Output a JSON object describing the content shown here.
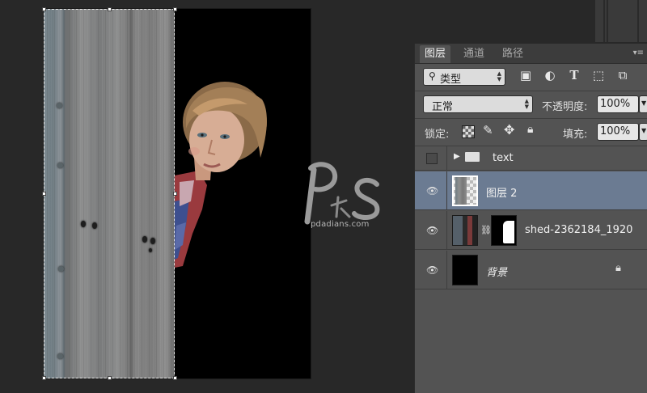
{
  "panel": {
    "tabs": [
      {
        "label": "图层",
        "active": true
      },
      {
        "label": "通道",
        "active": false
      },
      {
        "label": "路径",
        "active": false
      }
    ],
    "filter": {
      "label": "类型",
      "icon": "search-icon"
    },
    "filter_icons": [
      "image-filter-icon",
      "adjustment-filter-icon",
      "type-filter-icon",
      "shape-filter-icon",
      "smart-object-filter-icon"
    ],
    "blend_mode": "正常",
    "opacity_label": "不透明度:",
    "opacity_value": "100%",
    "lock_label": "锁定:",
    "fill_label": "填充:",
    "fill_value": "100%",
    "lock_icons": [
      "lock-transparent-icon",
      "lock-paint-icon",
      "lock-move-icon",
      "lock-all-icon"
    ]
  },
  "layers": [
    {
      "name": "text",
      "type": "group",
      "visible": false,
      "selected": false
    },
    {
      "name": "图层 2",
      "type": "pixel",
      "visible": true,
      "selected": true
    },
    {
      "name": "shed-2362184_1920",
      "type": "masked",
      "visible": true,
      "selected": false
    },
    {
      "name": "背景",
      "type": "background",
      "visible": true,
      "selected": false,
      "locked": true
    }
  ],
  "watermark": {
    "text": "pdadians.com"
  },
  "colors": {
    "panel_bg": "#535353",
    "selected_row": "#6b7b92",
    "workspace_bg": "#282828",
    "canvas_bg": "#000000"
  }
}
